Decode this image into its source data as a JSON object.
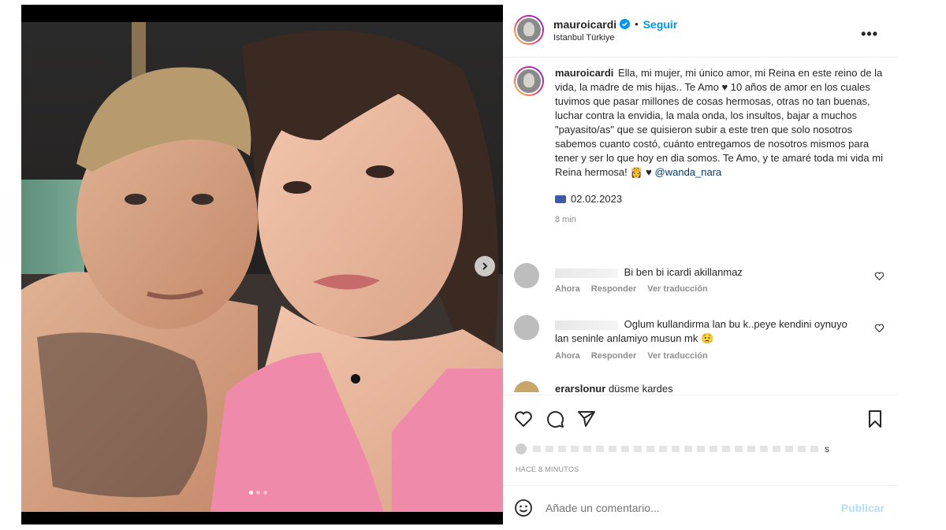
{
  "post": {
    "username": "mauroicardi",
    "separator": "•",
    "follow_label": "Seguir",
    "location": "Istanbul Türkiye",
    "more_label": "•••"
  },
  "caption": {
    "username": "mauroicardi",
    "text": "Ella, mi mujer, mi único amor, mi Reina en este reino de la vida, la madre de mis hijas.. Te Amo ♥ 10 años de amor en los cuales tuvimos que pasar millones de cosas hermosas, otras no tan buenas, luchar contra la envidia, la mala onda, los insultos, bajar a muchos \"payasito/as\" que se quisieron subir a este tren que solo nosotros sabemos cuanto costó, cuánto entregamos de nosotros mismos para tener y ser lo que hoy en dia somos. Te Amo, y te amaré toda mi vida mi Reina hermosa! 👸 ♥",
    "mention": "@wanda_nara",
    "date": "02.02.2023",
    "age": "8 min"
  },
  "comments": [
    {
      "text": "Bi ben bi icardi akillanmaz",
      "time": "Ahora",
      "reply_label": "Responder",
      "translate_label": "Ver traducción"
    },
    {
      "text": "Oglum kullandirma lan bu k..peye kendini oynuyo lan seninle anlamiyo musun mk 😟",
      "time": "Ahora",
      "reply_label": "Responder",
      "translate_label": "Ver traducción"
    },
    {
      "username": "erarslonur",
      "text": "düsme kardes"
    }
  ],
  "actions": {
    "like_icon": "heart-icon",
    "comment_icon": "comment-icon",
    "share_icon": "send-icon",
    "save_icon": "bookmark-icon"
  },
  "likes": {
    "tail": "s"
  },
  "posted_ago": "HACE 8 MINUTOS",
  "comment_box": {
    "placeholder": "Añade un comentario...",
    "publish_label": "Publicar"
  },
  "carousel": {
    "slides": 3,
    "active_index": 0
  },
  "colors": {
    "accent": "#0095f6",
    "link": "#00376b",
    "publish_disabled": "#b2dffc"
  }
}
